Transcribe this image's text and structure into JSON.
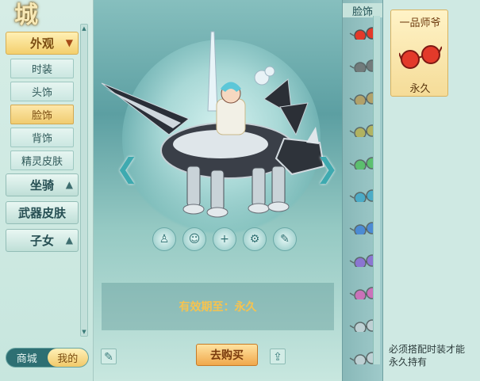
{
  "logo": {
    "text": "城"
  },
  "sidebar": {
    "categories": [
      {
        "label": "外观",
        "expanded": true
      },
      {
        "label": "坐骑",
        "expanded": false
      },
      {
        "label": "武器皮肤"
      },
      {
        "label": "子女",
        "expanded": false
      }
    ],
    "sub_items": [
      "时装",
      "头饰",
      "脸饰",
      "背饰",
      "精灵皮肤"
    ],
    "active_sub": "脸饰"
  },
  "bottom_tabs": {
    "mall": "商城",
    "mine": "我的"
  },
  "preview": {
    "validity": "有效期至：永久",
    "buy_label": "去购买",
    "action_icons": [
      "figure-icon",
      "face-icon",
      "plus-icon",
      "pose-icon",
      "dye-icon"
    ]
  },
  "item_column": {
    "header": "脸饰",
    "glasses_colors": [
      "#e33a2a",
      "#6a6a6a",
      "#b99a55",
      "#b9b04a",
      "#4fbf5b",
      "#3aa6c8",
      "#3b7ed8",
      "#8a64d6",
      "#d85fb8",
      "#c9d4d8",
      "#c9d4d8"
    ]
  },
  "detail": {
    "title": "一品师爷",
    "permanence": "永久",
    "note_line1": "必须搭配时装才能",
    "note_line2": "永久持有"
  },
  "colors": {
    "accent_gold": "#f0cc71",
    "teal": "#2e6f73",
    "validity_text": "#f6c34f"
  }
}
